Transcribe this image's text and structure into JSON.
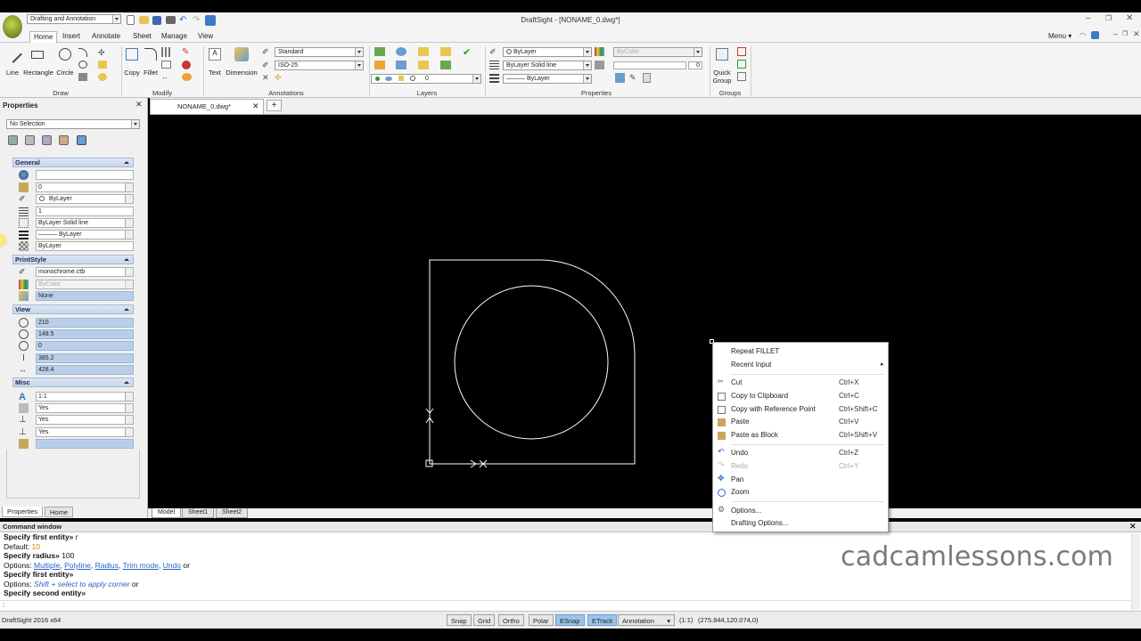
{
  "titlebar": {
    "workspace": "Drafting and Annotation",
    "title": "DraftSight - [NONAME_0.dwg*]",
    "menu_label": "Menu"
  },
  "ribbon_tabs": [
    "Home",
    "Insert",
    "Annotate",
    "Sheet",
    "Manage",
    "View"
  ],
  "ribbon": {
    "draw": {
      "line": "Line",
      "rectangle": "Rectangle",
      "circle": "Circle",
      "group": "Draw"
    },
    "modify": {
      "copy": "Copy",
      "fillet": "Fillet",
      "group": "Modify"
    },
    "annotations": {
      "text": "Text",
      "dimension": "Dimension",
      "text_style": "Standard",
      "dim_style": "ISO-25",
      "group": "Annotations"
    },
    "layers": {
      "layer": "0",
      "group": "Layers"
    },
    "properties": {
      "color": "ByLayer",
      "linestyle": "ByLayer    Solid line",
      "lineweight": "——— ByLayer",
      "print_color": "ByColor",
      "transparency": "0",
      "group": "Properties"
    },
    "groups": {
      "quick_group_1": "Quick",
      "quick_group_2": "Group",
      "group": "Groups"
    }
  },
  "properties_panel": {
    "title": "Properties",
    "selection": "No Selection",
    "general": {
      "header": "General",
      "rows": [
        "",
        "0",
        "ByLayer",
        "1",
        "ByLayer    Solid line",
        "——— ByLayer",
        "ByLayer"
      ]
    },
    "printstyle": {
      "header": "PrintStyle",
      "rows": [
        "monochrome.ctb",
        "ByColor",
        "None"
      ]
    },
    "view": {
      "header": "View",
      "rows": [
        "210",
        "148.5",
        "0",
        "385.2",
        "428.4"
      ]
    },
    "misc": {
      "header": "Misc",
      "rows": [
        "1:1",
        "Yes",
        "Yes",
        "Yes",
        ""
      ]
    },
    "bottom_tabs": [
      "Properties",
      "Home"
    ]
  },
  "doc_tab": "NONAME_0.dwg*",
  "sheet_tabs": [
    "Model",
    "Sheet1",
    "Sheet2"
  ],
  "context_menu": {
    "repeat": "Repeat FILLET",
    "recent": "Recent Input",
    "cut": {
      "label": "Cut",
      "shortcut": "Ctrl+X"
    },
    "copy": {
      "label": "Copy to Clipboard",
      "shortcut": "Ctrl+C"
    },
    "copyref": {
      "label": "Copy with Reference Point",
      "shortcut": "Ctrl+Shift+C"
    },
    "paste": {
      "label": "Paste",
      "shortcut": "Ctrl+V"
    },
    "pasteblock": {
      "label": "Paste as Block",
      "shortcut": "Ctrl+Shift+V"
    },
    "undo": {
      "label": "Undo",
      "shortcut": "Ctrl+Z"
    },
    "redo": {
      "label": "Redo",
      "shortcut": "Ctrl+Y"
    },
    "pan": "Pan",
    "zoom": "Zoom",
    "options": "Options...",
    "drafting": "Drafting Options..."
  },
  "command_window": {
    "title": "Command window",
    "l1": "Specify first entity»",
    "l1b": " r",
    "l2a": "Default: ",
    "l2b": "10",
    "l3a": "Specify radius»",
    "l3b": " 100",
    "l4a": "Options: ",
    "l4opt1": "Multiple",
    "l4opt2": "Polyline",
    "l4opt3": "Radius",
    "l4opt4": "Trim mode",
    "l4opt5": "Undo",
    "l4c": " or",
    "l5": "Specify first entity»",
    "l6a": "Options: ",
    "l6b": "Shift + select to apply corner",
    "l6c": " or",
    "l7": "Specify second entity»",
    "prompt": ":"
  },
  "statusbar": {
    "app": "DraftSight 2016 x64",
    "buttons": [
      "Snap",
      "Grid",
      "Ortho",
      "Polar",
      "ESnap",
      "ETrack"
    ],
    "annotation": "Annotation",
    "scale": "(1:1)",
    "coords": "(275.844,120.074,0)"
  },
  "watermark": "cadcamlessons.com",
  "colors": {
    "accent": "#9cc3ec",
    "canvas": "#000000",
    "link": "#2a66c8"
  }
}
